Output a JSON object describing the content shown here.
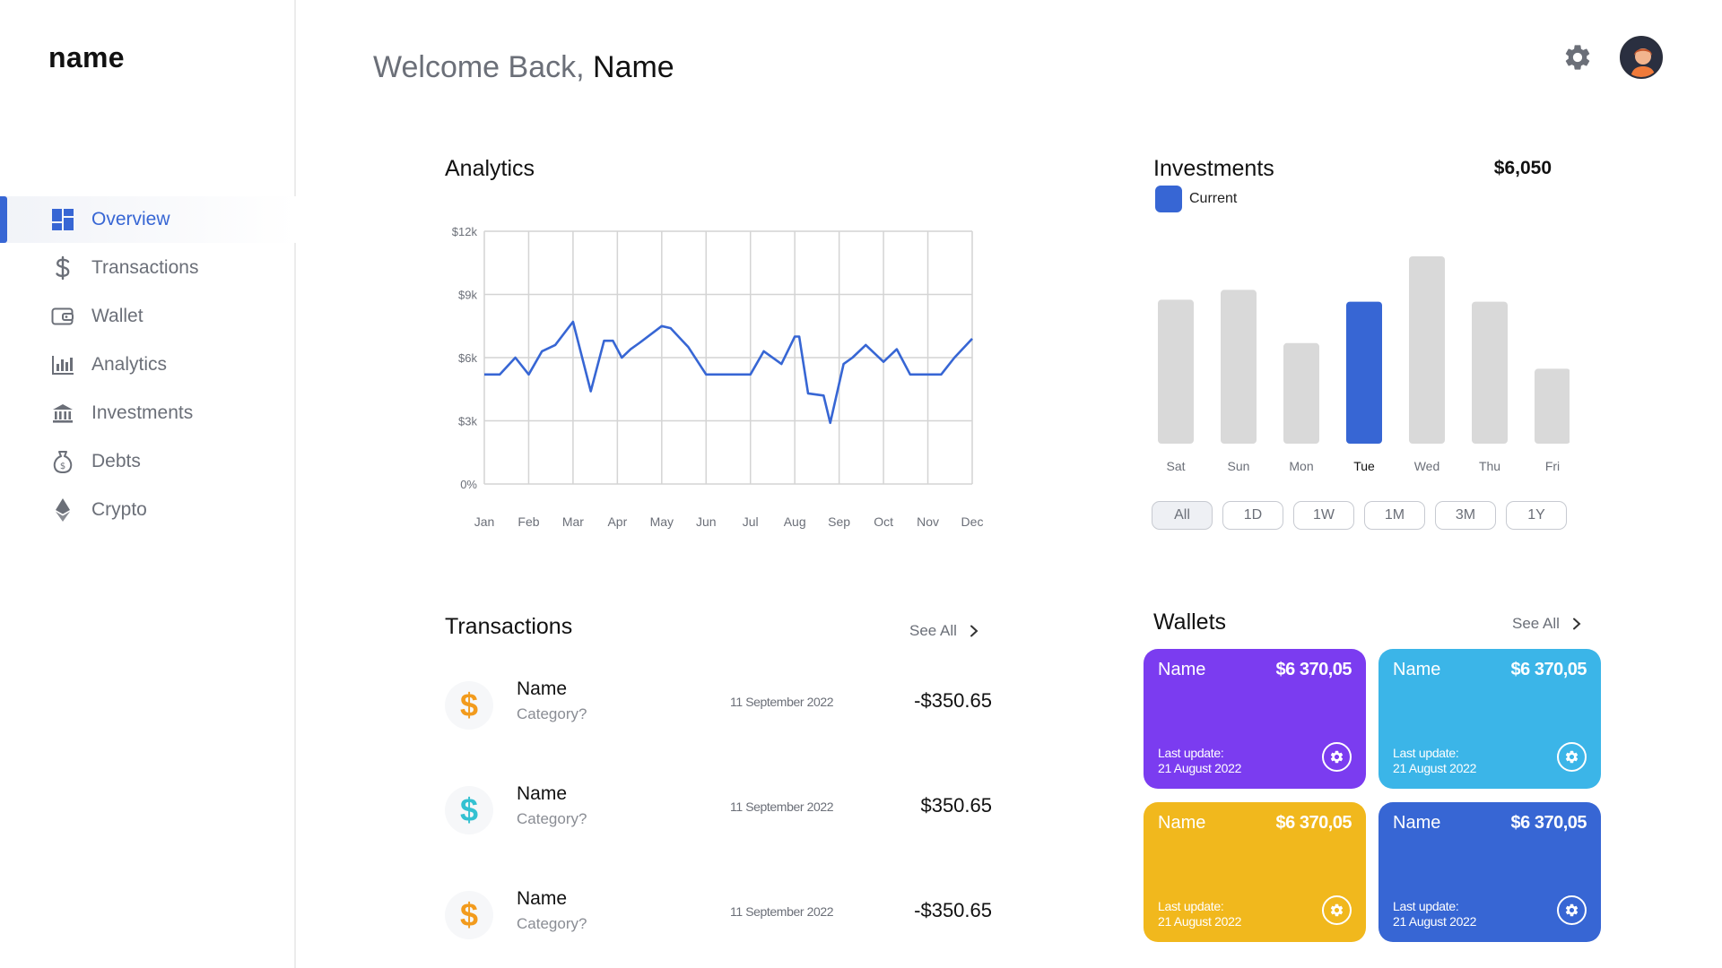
{
  "brand": "name",
  "nav": [
    {
      "label": "Overview",
      "icon": "dashboard-icon",
      "active": true
    },
    {
      "label": "Transactions",
      "icon": "dollar-icon",
      "active": false
    },
    {
      "label": "Wallet",
      "icon": "wallet-icon",
      "active": false
    },
    {
      "label": "Analytics",
      "icon": "bar-chart-icon",
      "active": false
    },
    {
      "label": "Investments",
      "icon": "bank-icon",
      "active": false
    },
    {
      "label": "Debts",
      "icon": "money-bag-icon",
      "active": false
    },
    {
      "label": "Crypto",
      "icon": "ethereum-icon",
      "active": false
    }
  ],
  "header": {
    "welcome": "Welcome Back,",
    "name": "Name",
    "settings_icon": "gear-icon",
    "avatar_icon": "user-avatar-icon"
  },
  "colors": {
    "accent": "#3766d4",
    "bar_inactive": "#d9d9d9",
    "wallet_purple": "#7b3cf0",
    "wallet_cyan": "#3bb5e8",
    "wallet_yellow": "#f1b81d",
    "wallet_blue": "#3766d4",
    "dollar_orange": "#f29b1d",
    "dollar_teal": "#34c1d1"
  },
  "analytics": {
    "title": "Analytics",
    "chart_data": {
      "type": "line",
      "x": [
        "Jan",
        "Feb",
        "Mar",
        "Apr",
        "May",
        "Jun",
        "Jul",
        "Aug",
        "Sep",
        "Oct",
        "Nov",
        "Dec"
      ],
      "y_ticks": [
        "$12k",
        "$9k",
        "$6k",
        "$3k",
        "0%"
      ],
      "ylim": [
        0,
        12000
      ],
      "grid": true,
      "series": [
        {
          "x": [
            0,
            0.35,
            0.7,
            1.0,
            1.3,
            1.6,
            2.0,
            2.4,
            2.7,
            2.9,
            3.1,
            3.3,
            3.5,
            4.0,
            4.2,
            4.6,
            5.0,
            5.3,
            5.6,
            6.0,
            6.3,
            6.7,
            7.0,
            7.1,
            7.3,
            7.65,
            7.8,
            8.1,
            8.3,
            8.6,
            9.0,
            9.3,
            9.6,
            10.0,
            10.3,
            10.6,
            11.0
          ],
          "y": [
            5200,
            5200,
            6000,
            5200,
            6300,
            6600,
            7700,
            4400,
            6800,
            6800,
            6000,
            6400,
            6700,
            7500,
            7400,
            6500,
            5200,
            5200,
            5200,
            5200,
            6300,
            5700,
            7000,
            7000,
            4300,
            4200,
            2900,
            5700,
            6000,
            6600,
            5800,
            6400,
            5200,
            5200,
            5200,
            6000,
            6900
          ]
        }
      ]
    }
  },
  "investments": {
    "title": "Investments",
    "total": "$6,050",
    "legend": "Current",
    "chart_data": {
      "type": "bar",
      "categories": [
        "Sat",
        "Sun",
        "Mon",
        "Tue",
        "Wed",
        "Thu",
        "Fri"
      ],
      "values": [
        73,
        78,
        51,
        72,
        95,
        72,
        38
      ],
      "highlight": "Tue"
    },
    "ranges": [
      "All",
      "1D",
      "1W",
      "1M",
      "3M",
      "1Y"
    ],
    "active_range": "All"
  },
  "transactions": {
    "title": "Transactions",
    "see_all": "See All",
    "items": [
      {
        "name": "Name",
        "category": "Category?",
        "date": "11 September 2022",
        "amount": "-$350.65",
        "icon": "dollar-icon",
        "icon_color": "#f29b1d"
      },
      {
        "name": "Name",
        "category": "Category?",
        "date": "11 September 2022",
        "amount": "$350.65",
        "icon": "dollar-icon",
        "icon_color": "#34c1d1"
      },
      {
        "name": "Name",
        "category": "Category?",
        "date": "11 September 2022",
        "amount": "-$350.65",
        "icon": "dollar-icon",
        "icon_color": "#f29b1d"
      }
    ]
  },
  "wallets": {
    "title": "Wallets",
    "see_all": "See All",
    "items": [
      {
        "name": "Name",
        "amount": "$6 370,05",
        "update_label": "Last update:",
        "update_date": "21 August 2022",
        "color": "#7b3cf0"
      },
      {
        "name": "Name",
        "amount": "$6 370,05",
        "update_label": "Last update:",
        "update_date": "21 August 2022",
        "color": "#3bb5e8"
      },
      {
        "name": "Name",
        "amount": "$6 370,05",
        "update_label": "Last update:",
        "update_date": "21 August 2022",
        "color": "#f1b81d"
      },
      {
        "name": "Name",
        "amount": "$6 370,05",
        "update_label": "Last update:",
        "update_date": "21 August 2022",
        "color": "#3766d4"
      }
    ]
  }
}
